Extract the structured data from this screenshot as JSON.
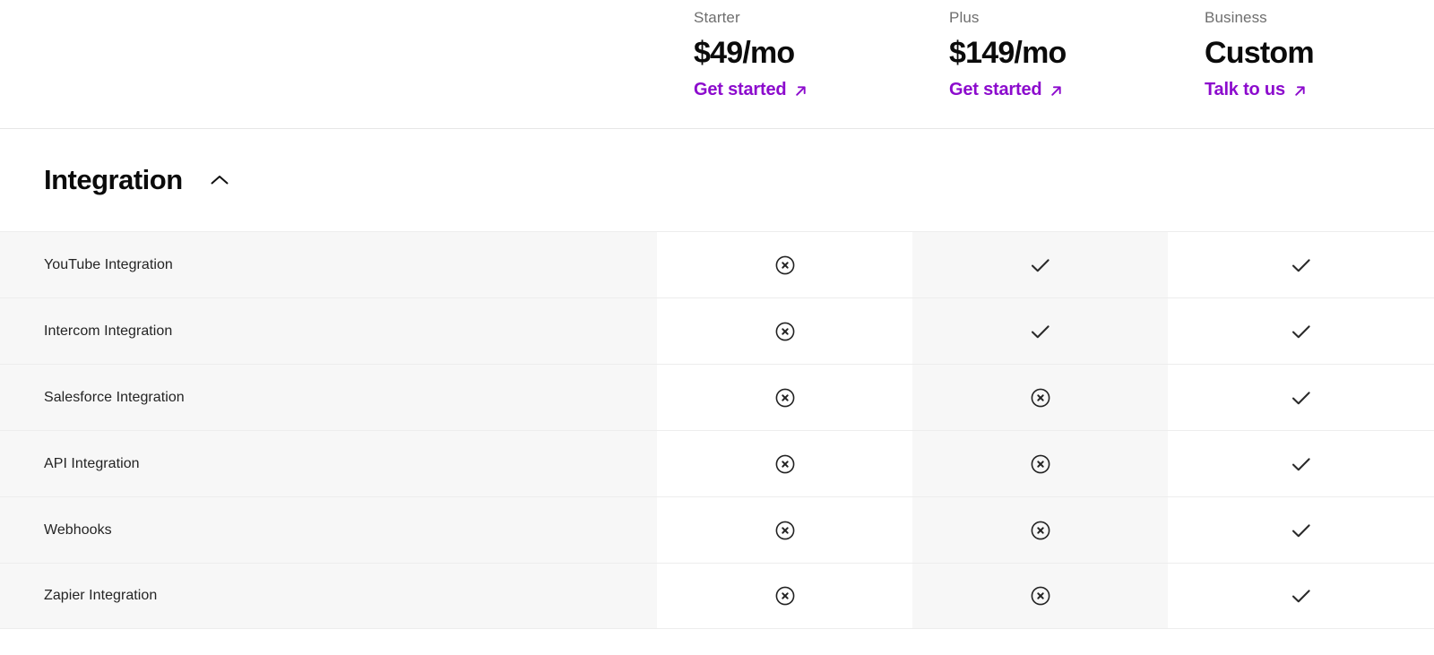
{
  "accent_color": "#8c0bcd",
  "plans": [
    {
      "name": "Starter",
      "price": "$49/mo",
      "cta": "Get started",
      "cta_icon": "arrow-up-right-icon"
    },
    {
      "name": "Plus",
      "price": "$149/mo",
      "cta": "Get started",
      "cta_icon": "arrow-up-right-icon"
    },
    {
      "name": "Business",
      "price": "Custom",
      "cta": "Talk to us",
      "cta_icon": "arrow-up-right-icon"
    }
  ],
  "section": {
    "title": "Integration",
    "toggle_icon": "chevron-up-icon",
    "expanded": true
  },
  "features": [
    {
      "label": "YouTube Integration",
      "values": [
        "no",
        "yes",
        "yes"
      ]
    },
    {
      "label": "Intercom Integration",
      "values": [
        "no",
        "yes",
        "yes"
      ]
    },
    {
      "label": "Salesforce Integration",
      "values": [
        "no",
        "no",
        "yes"
      ]
    },
    {
      "label": "API Integration",
      "values": [
        "no",
        "no",
        "yes"
      ]
    },
    {
      "label": "Webhooks",
      "values": [
        "no",
        "no",
        "yes"
      ]
    },
    {
      "label": "Zapier Integration",
      "values": [
        "no",
        "no",
        "yes"
      ]
    }
  ],
  "icons": {
    "yes": "check-icon",
    "no": "circle-x-icon"
  }
}
